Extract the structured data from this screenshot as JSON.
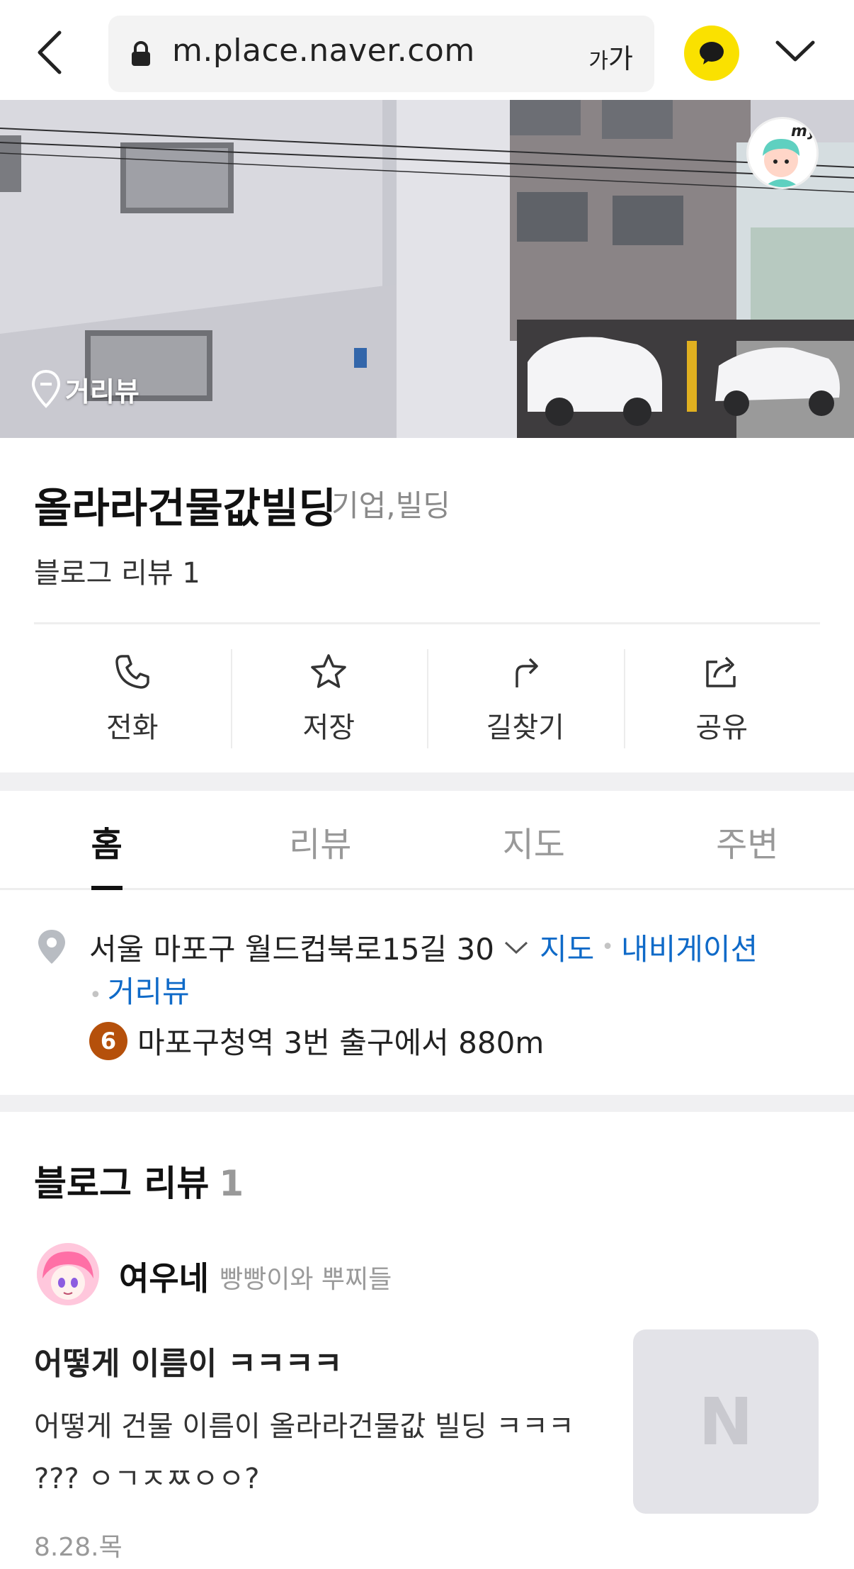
{
  "browser": {
    "url": "m.place.naver.com",
    "font_size_label_small": "가",
    "font_size_label_large": "가",
    "icons": [
      "back-arrow-icon",
      "lock-icon",
      "kakaotalk-icon",
      "chevron-down-icon"
    ]
  },
  "hero": {
    "street_view_label": "거리뷰",
    "my_badge": "my"
  },
  "place": {
    "name": "올라라건물값빌딩",
    "category": "기업,빌딩",
    "blog_review_summary": "블로그 리뷰 1"
  },
  "actions": [
    {
      "label": "전화",
      "icon": "phone-icon"
    },
    {
      "label": "저장",
      "icon": "star-icon"
    },
    {
      "label": "길찾기",
      "icon": "directions-icon"
    },
    {
      "label": "공유",
      "icon": "share-icon"
    }
  ],
  "tabs": [
    {
      "label": "홈",
      "active": true
    },
    {
      "label": "리뷰",
      "active": false
    },
    {
      "label": "지도",
      "active": false
    },
    {
      "label": "주변",
      "active": false
    }
  ],
  "address": {
    "text": "서울 마포구 월드컵북로15길 30",
    "link_map": "지도",
    "link_navigation": "내비게이션",
    "link_street_view": "거리뷰",
    "subway_line": "6",
    "subway_line_color": "#b5500b",
    "subway_text": "마포구청역 3번 출구에서 880m"
  },
  "blog_reviews": {
    "title": "블로그 리뷰",
    "count": "1",
    "item": {
      "author": "여우네",
      "blog_name": "빵빵이와 뿌찌들",
      "title": "어떻게 이름이 ㅋㅋㅋㅋ",
      "body_line1": "어떻게 건물 이름이 올라라건물값 빌딩 ㅋㅋㅋ",
      "body_line2": "??? ㅇㄱㅈㅉㅇㅇ?",
      "date": "8.28.목",
      "thumbnail_placeholder": "N"
    }
  },
  "colors": {
    "link": "#0f6ac8",
    "kakao_yellow": "#fae100",
    "active_tab": "#111111"
  }
}
